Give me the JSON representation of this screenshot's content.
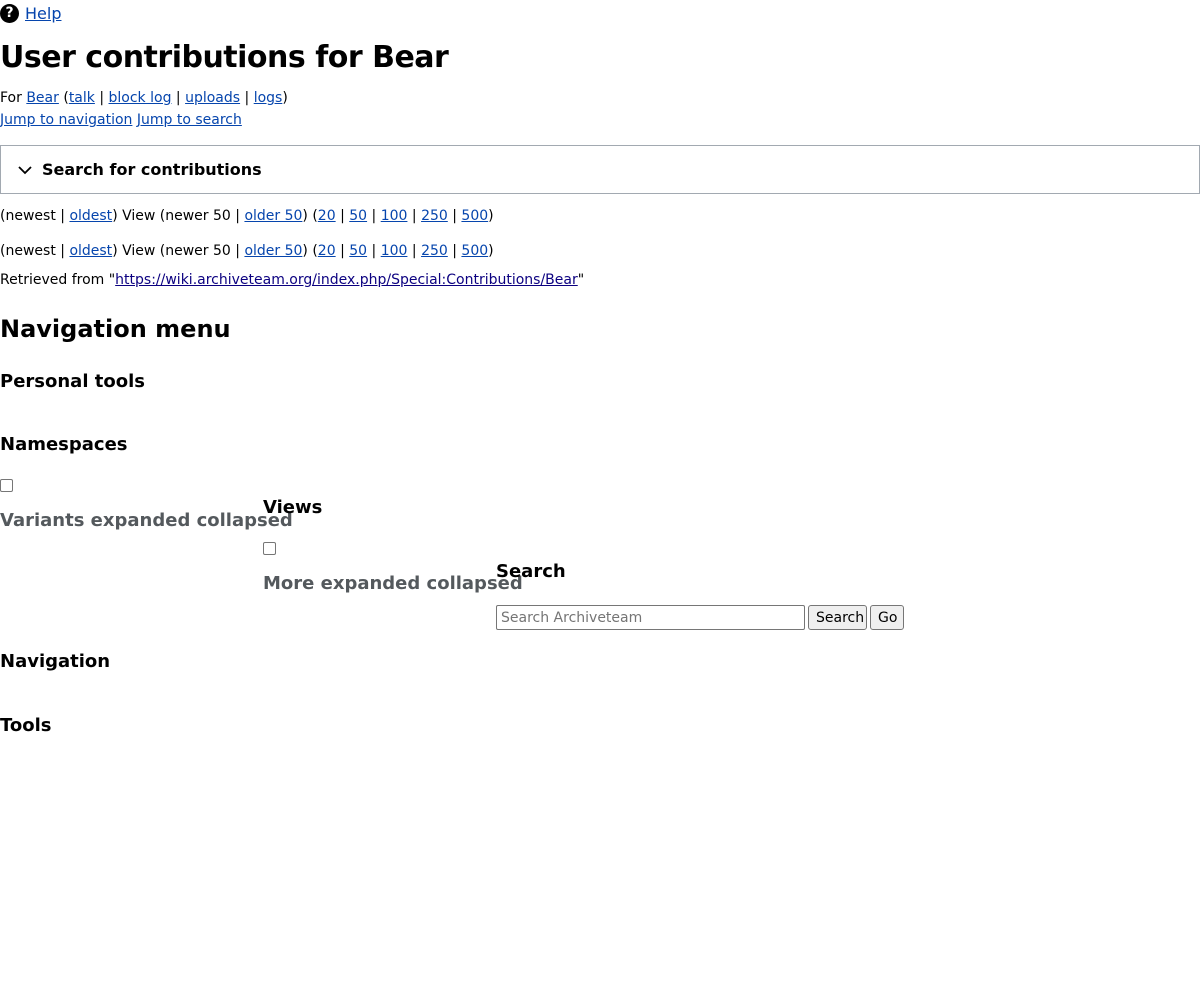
{
  "help": {
    "label": "Help",
    "icon": "help-icon"
  },
  "page_title": "User contributions for Bear",
  "for_line": {
    "prefix": "For",
    "user": "Bear",
    "talk": "talk",
    "block_log": "block log",
    "uploads": "uploads",
    "logs": "logs",
    "open_paren": "(",
    "close_paren": ")",
    "sep": "|"
  },
  "jump": {
    "navigation": "Jump to navigation",
    "search": "Jump to search"
  },
  "search_contributions": {
    "label": "Search for contributions",
    "icon": "chevron-down-icon"
  },
  "pager": {
    "open_paren": "(",
    "newest": "newest",
    "sep": "|",
    "oldest": "oldest",
    "view_text": ") View (newer 50 |",
    "older": "older 50",
    "mid": ") (",
    "counts": [
      "20",
      "50",
      "100",
      "250",
      "500"
    ],
    "close": ")"
  },
  "retrieved": {
    "prefix": "Retrieved from \"",
    "url": "https://wiki.archiveteam.org/index.php/Special:Contributions/Bear",
    "suffix": "\""
  },
  "headings": {
    "navigation_menu": "Navigation menu",
    "personal_tools": "Personal tools",
    "namespaces": "Namespaces",
    "variants": "Variants expanded collapsed",
    "views": "Views",
    "more": "More expanded collapsed",
    "search": "Search",
    "navigation": "Navigation",
    "tools": "Tools"
  },
  "search": {
    "placeholder": "Search Archiveteam",
    "search_button": "Search",
    "go_button": "Go"
  }
}
